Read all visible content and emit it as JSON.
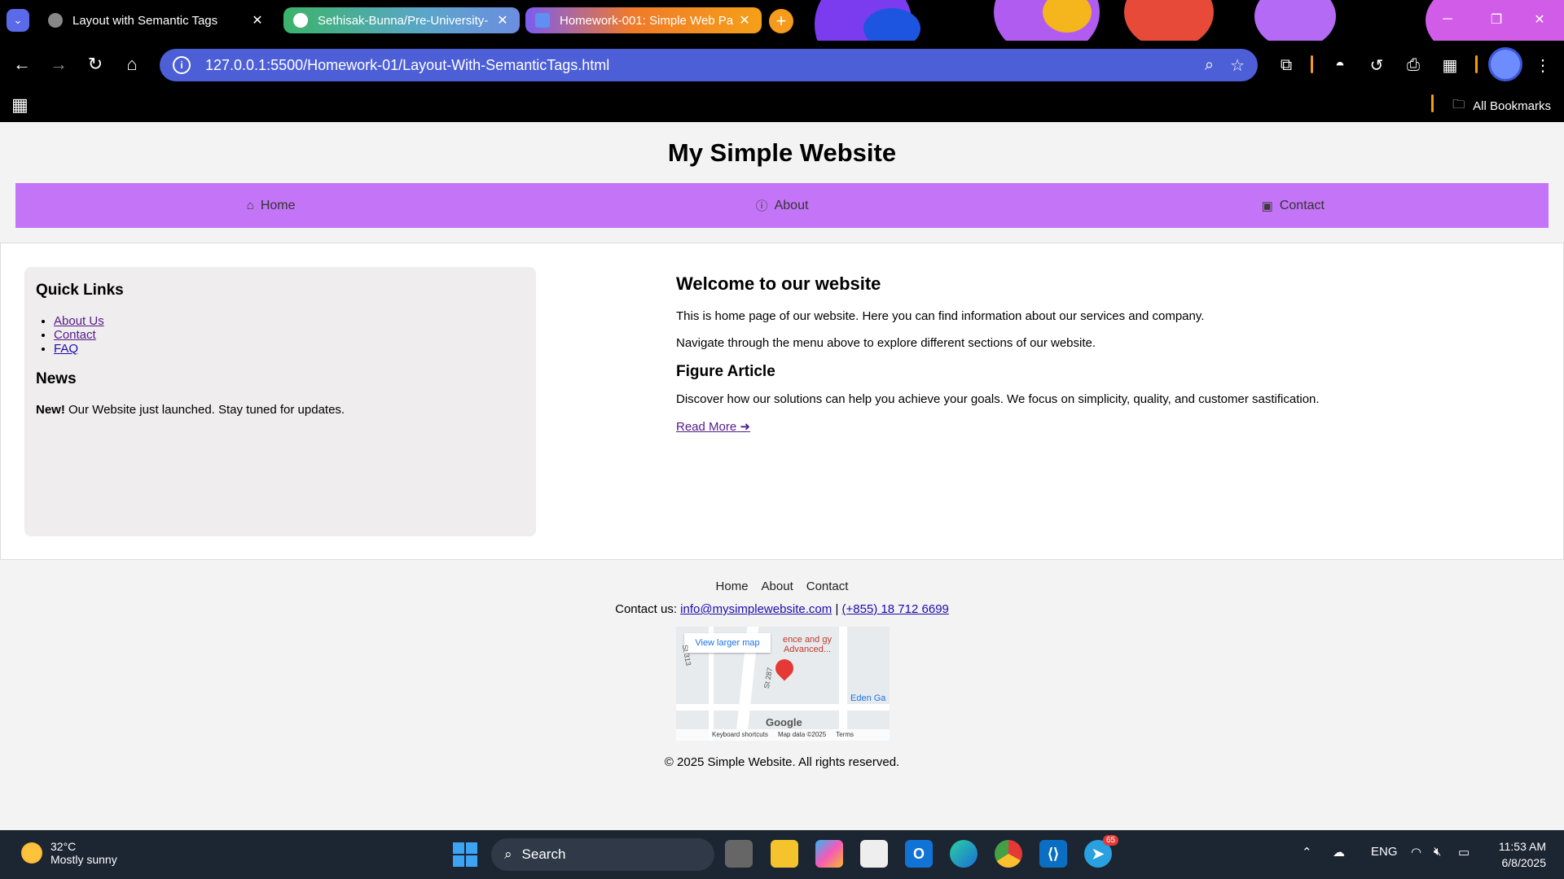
{
  "browser": {
    "tabs": [
      {
        "title": "Layout with Semantic Tags",
        "active": true
      },
      {
        "title": "Sethisak-Bunna/Pre-University-",
        "active": false
      },
      {
        "title": "Homework-001: Simple Web Pa",
        "active": false
      }
    ],
    "new_tab_label": "+",
    "url": "127.0.0.1:5500/Homework-01/Layout-With-SemanticTags.html",
    "bookmarks_label": "All Bookmarks"
  },
  "site": {
    "title": "My Simple Website",
    "nav": [
      {
        "label": "Home",
        "icon": "home-icon"
      },
      {
        "label": "About",
        "icon": "info-icon"
      },
      {
        "label": "Contact",
        "icon": "contact-book-icon"
      }
    ]
  },
  "aside": {
    "quick_links_title": "Quick Links",
    "links": [
      "About Us",
      "Contact",
      "FAQ"
    ],
    "news_title": "News",
    "news_bold": "New!",
    "news_text": " Our Website just launched. Stay tuned for updates."
  },
  "article": {
    "title": "Welcome to our website",
    "p1": "This is home page of our website. Here you can find information about our services and company.",
    "p2": "Navigate through the menu above to explore different sections of our website.",
    "figure_title": "Figure Article",
    "figure_text": "Discover how our solutions can help you achieve your goals. We focus on simplicity, quality, and customer sastification.",
    "read_more": "Read More"
  },
  "footer": {
    "links": [
      "Home",
      "About",
      "Contact"
    ],
    "contact_prefix": "Contact us: ",
    "email": "info@mysimplewebsite.com",
    "separator": " | ",
    "phone": "(+855) 18 712 6699",
    "map": {
      "view_larger": "View larger map",
      "place_label": "ence and gy Advanced...",
      "street1": "St 287",
      "street2": "St 313",
      "area": "Eden Ga",
      "logo": "Google",
      "keyboard": "Keyboard shortcuts",
      "map_data": "Map data ©2025",
      "terms": "Terms"
    },
    "copyright": "© 2025 Simple Website. All rights reserved."
  },
  "taskbar": {
    "temperature": "32°C",
    "weather": "Mostly sunny",
    "search": "Search",
    "telegram_badge": "65",
    "language": "ENG",
    "time": "11:53 AM",
    "date": "6/8/2025"
  },
  "colors": {
    "nav_bg": "#c474f7",
    "omnibox_bg": "#4d5fd6",
    "visited_link": "#551a8b",
    "link": "#1a0dab"
  }
}
